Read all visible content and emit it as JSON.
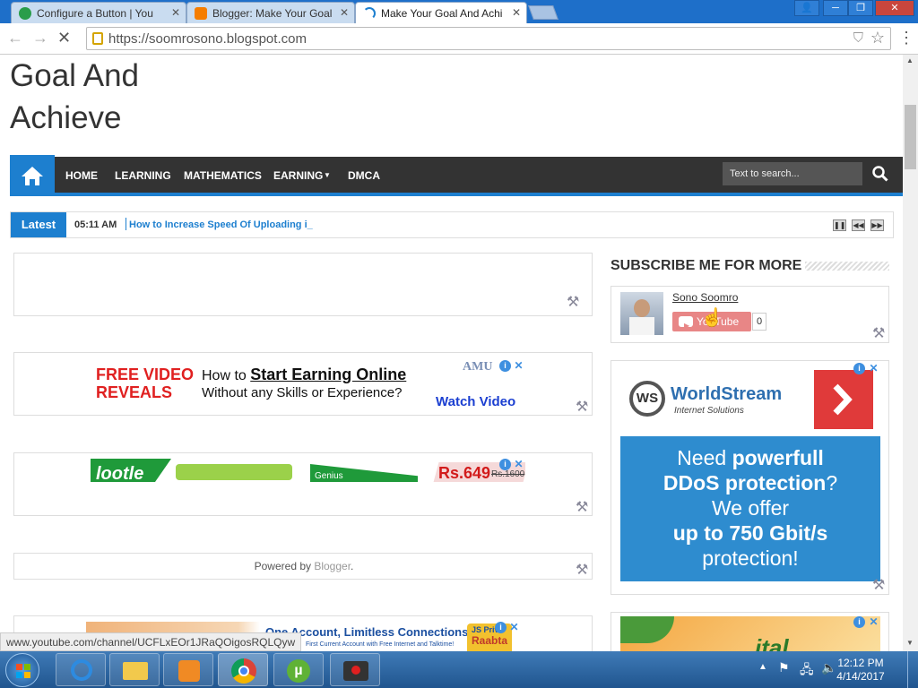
{
  "browser": {
    "tabs": [
      {
        "title": "Configure a Button | You",
        "active": false
      },
      {
        "title": "Blogger: Make Your Goal",
        "active": false
      },
      {
        "title": "Make Your Goal And Achi",
        "active": true
      }
    ],
    "url": "https://soomrosono.blogspot.com",
    "status_url": "www.youtube.com/channel/UCFLxEOr1JRaQOigosRQLQyw"
  },
  "site": {
    "title_line1": "Goal And",
    "title_line2": "Achieve",
    "nav": [
      "HOME",
      "LEARNING",
      "MATHEMATICS",
      "EARNING",
      "DMCA"
    ],
    "search_placeholder": "Text to search..."
  },
  "ticker": {
    "label": "Latest",
    "time": "05:11 AM",
    "headline": "How to Increase Speed Of Uploading i_"
  },
  "ads": {
    "ad1_line1_red": "FREE VIDEO",
    "ad1_line2_red": "REVEALS",
    "ad1_text_a": "How to",
    "ad1_text_b": "Start Earning Online",
    "ad1_text_c": "Without any Skills or Experience?",
    "ad1_cta": "Watch Video",
    "ad1_brand": "AMU",
    "ad2_brand": "lootle",
    "ad2_price": "Rs.649",
    "ad2_oldprice": "Rs.1600",
    "ad2_tag": "Genius",
    "ad3_text": "One Account, Limitless Connections",
    "ad3_sub": "First Current Account with Free Internet and Talktime!",
    "ad3_brand_a": "JS Priv",
    "ad3_brand_b": "Raabta",
    "ws_brand": "WorldStream",
    "ws_sub": "Internet Solutions",
    "ws_line1a": "Need ",
    "ws_line1b": "powerfull",
    "ws_line2a": "DDoS protection",
    "ws_line2b": "?",
    "ws_line3": "We offer",
    "ws_line4": "up to 750 Gbit/s",
    "ws_line5": "protection!",
    "side_ad2_text": "ital"
  },
  "powered": {
    "prefix": "Powered by ",
    "link": "Blogger",
    "suffix": "."
  },
  "sidebar": {
    "title": "SUBSCRIBE ME FOR MORE",
    "channel_name": "Sono Soomro",
    "yt_label": "YouTube",
    "subs_count": "0"
  },
  "taskbar": {
    "time": "12:12 PM",
    "date": "4/14/2017"
  },
  "colors": {
    "accent": "#1d7fcf",
    "nav_bg": "#333333",
    "ad_red": "#e02020",
    "ws_blue": "#2e8ccf"
  }
}
